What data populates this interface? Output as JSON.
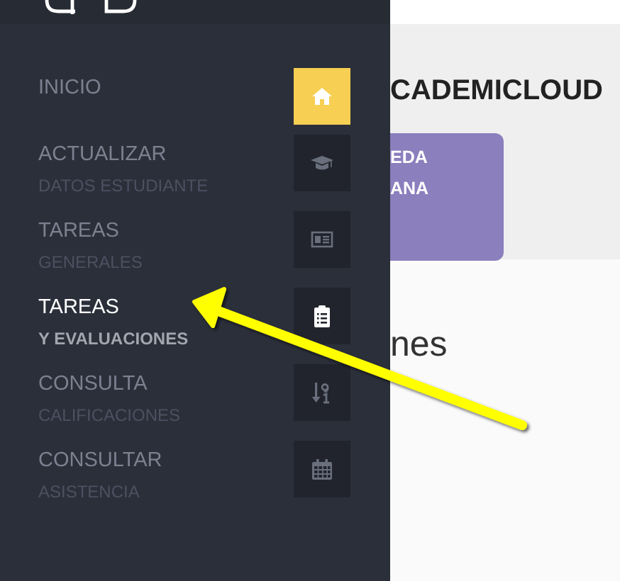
{
  "sidebar": {
    "items": [
      {
        "title": "INICIO",
        "selected": true,
        "highlighted": false
      },
      {
        "title": "ACTUALIZAR",
        "subtitle": "DATOS ESTUDIANTE",
        "selected": false,
        "highlighted": false
      },
      {
        "title": "TAREAS",
        "subtitle": "GENERALES",
        "selected": false,
        "highlighted": false
      },
      {
        "title": "TAREAS",
        "subtitle": "Y EVALUACIONES",
        "selected": false,
        "highlighted": true
      },
      {
        "title": "CONSULTA",
        "subtitle": "CALIFICACIONES",
        "selected": false,
        "highlighted": false
      },
      {
        "title": "CONSULTAR",
        "subtitle": "ASISTENCIA",
        "selected": false,
        "highlighted": false
      }
    ]
  },
  "main": {
    "heading": "CADEMICLOUD",
    "card_lines": [
      "EDA",
      "ANA"
    ],
    "section_title": "nes"
  }
}
